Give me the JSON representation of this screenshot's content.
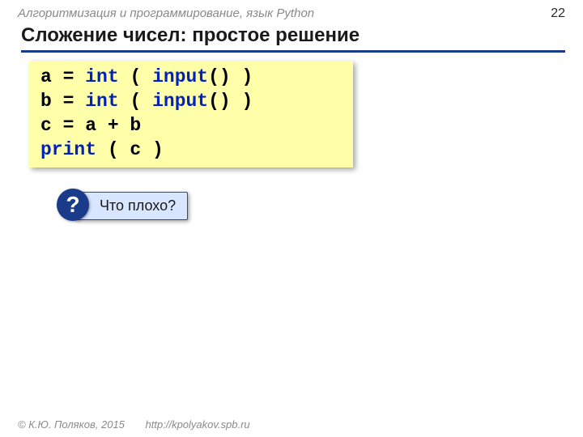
{
  "header": {
    "course_title": "Алгоритмизация и программирование, язык Python",
    "page_number": "22"
  },
  "title": "Сложение чисел: простое решение",
  "code": {
    "l1": {
      "a": "a",
      "eq": "=",
      "int": "int",
      "p": "( ",
      "input": "input",
      "rest": "() )"
    },
    "l2": {
      "b": "b",
      "eq": "=",
      "int": "int",
      "p": "( ",
      "input": "input",
      "rest": "() )"
    },
    "l3": {
      "text": "c = a + b"
    },
    "l4": {
      "print": "print",
      "rest": " ( c )"
    }
  },
  "question": {
    "badge": "?",
    "text": "Что плохо?"
  },
  "footer": {
    "copyright": "© К.Ю. Поляков, 2015",
    "url": "http://kpolyakov.spb.ru"
  }
}
